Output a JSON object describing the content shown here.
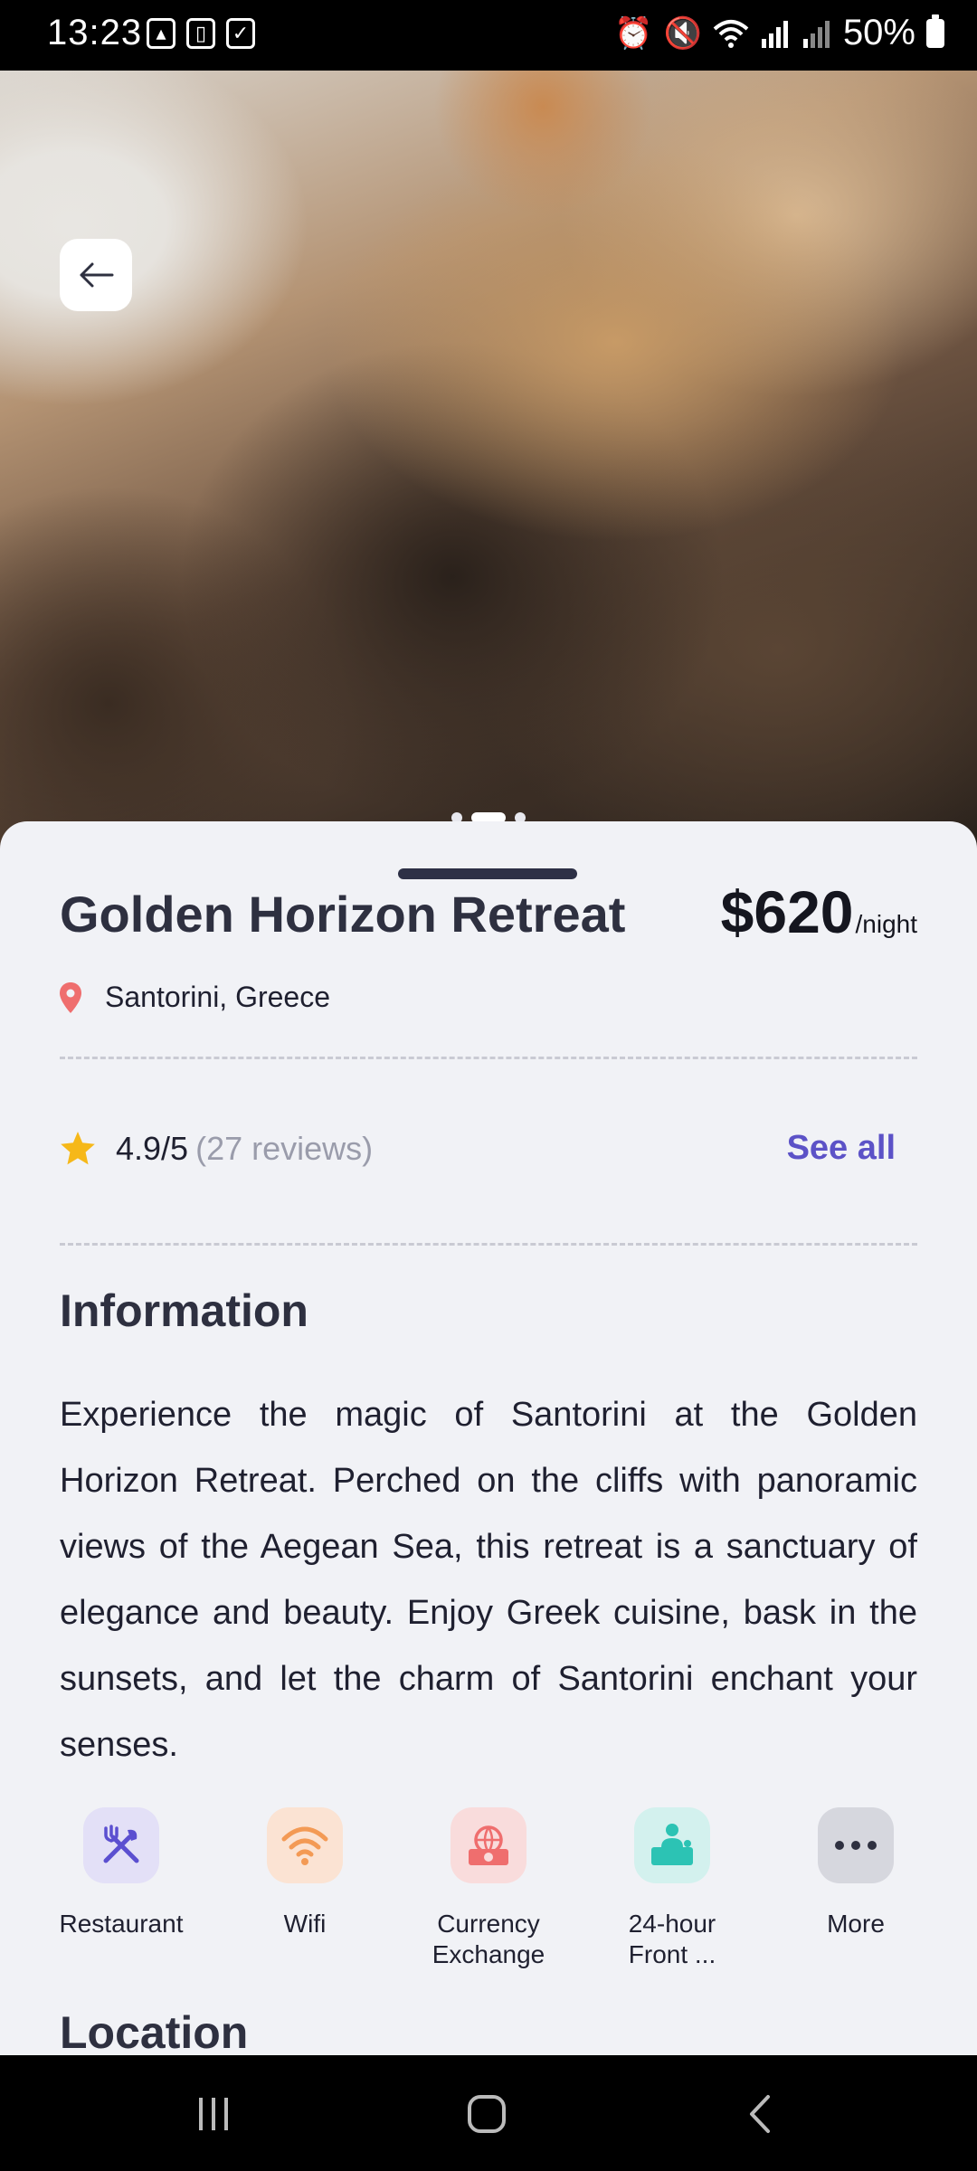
{
  "status_bar": {
    "time": "13:23",
    "battery": "50%"
  },
  "hero": {
    "image_description": "",
    "carousel_dots": 3,
    "active_dot_index": 1
  },
  "hotel": {
    "name": "Golden Horizon Retreat",
    "price": "$620",
    "price_unit": "/night",
    "location": "Santorini, Greece",
    "rating": "4.9/5",
    "reviews": "(27 reviews)",
    "see_all": "See all"
  },
  "information": {
    "title": "Information",
    "text": "Experience the magic of Santorini at the Golden Horizon Retreat. Perched on the cliffs with panoramic views of the Aegean Sea, this retreat is a sanctuary of elegance and beauty. Enjoy Greek cuisine, bask in the sunsets, and let the charm of Santorini enchant your senses."
  },
  "amenities": [
    {
      "label": "Restaurant",
      "icon": "restaurant-icon",
      "bg": "#e3e0f7",
      "color": "#5b4fd0"
    },
    {
      "label": "Wifi",
      "icon": "wifi-icon",
      "bg": "#fbe3d3",
      "color": "#f39a55"
    },
    {
      "label": "Currency Exchange",
      "icon": "currency-exchange-icon",
      "bg": "#f9dcdc",
      "color": "#ef6e6e"
    },
    {
      "label": "24-hour Front ...",
      "icon": "front-desk-icon",
      "bg": "#d3f1ee",
      "color": "#2cc3b4"
    },
    {
      "label": "More",
      "icon": "more-icon",
      "bg": "#d6d7de",
      "color": "#2e3040"
    }
  ],
  "location_section": {
    "title": "Location"
  },
  "colors": {
    "accent": "#5c52c7",
    "star": "#f6b819",
    "pin": "#ef6e6e"
  }
}
